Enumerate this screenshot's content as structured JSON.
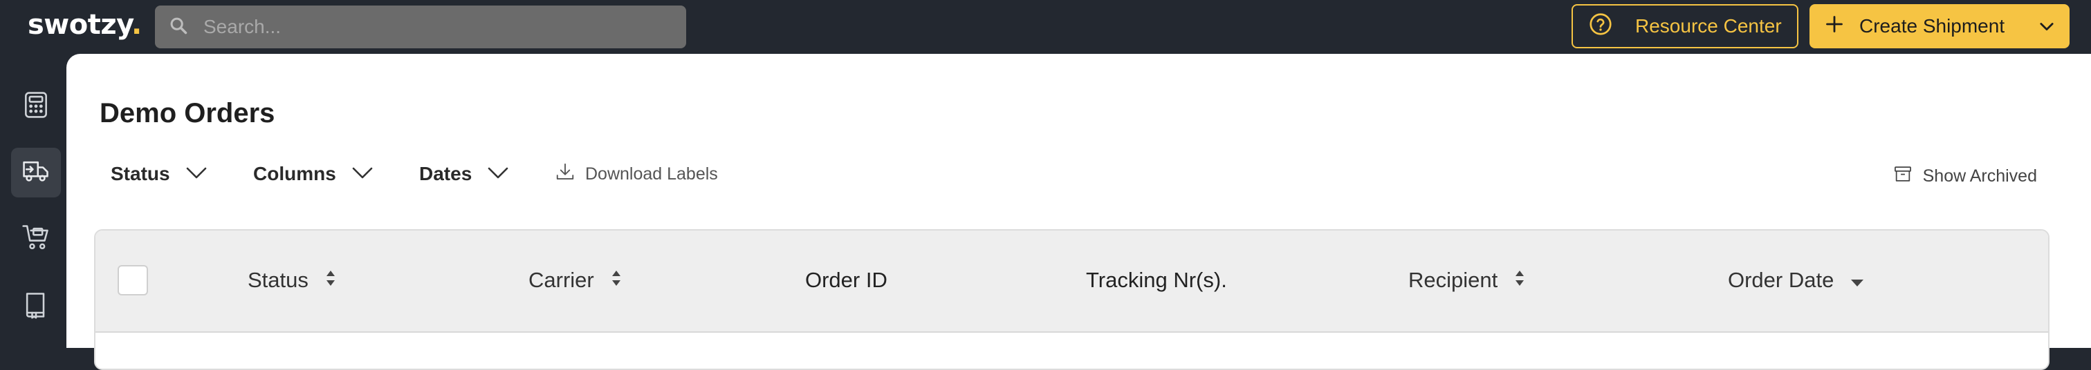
{
  "brand": {
    "name": "swotzy",
    "dot": "."
  },
  "search": {
    "placeholder": "Search..."
  },
  "header": {
    "resource_center_label": "Resource Center",
    "create_shipment_label": "Create Shipment"
  },
  "sidebar": {
    "items": [
      {
        "icon": "calculator-icon",
        "active": false
      },
      {
        "icon": "truck-shipments-icon",
        "active": true
      },
      {
        "icon": "cart-icon",
        "active": false
      },
      {
        "icon": "book-icon",
        "active": false
      }
    ]
  },
  "page": {
    "title": "Demo Orders",
    "filters": [
      "Status",
      "Columns",
      "Dates"
    ],
    "download_labels": "Download Labels",
    "show_archived": "Show Archived"
  },
  "table": {
    "columns": [
      {
        "label": "Status",
        "sort": "both"
      },
      {
        "label": "Carrier",
        "sort": "both"
      },
      {
        "label": "Order ID",
        "sort": "none"
      },
      {
        "label": "Tracking Nr(s).",
        "sort": "none"
      },
      {
        "label": "Recipient",
        "sort": "both"
      },
      {
        "label": "Order Date",
        "sort": "desc"
      }
    ]
  },
  "colors": {
    "topbar": "#232830",
    "accent": "#f6c443",
    "panel": "#ffffff",
    "table_header": "#eeeeee"
  }
}
